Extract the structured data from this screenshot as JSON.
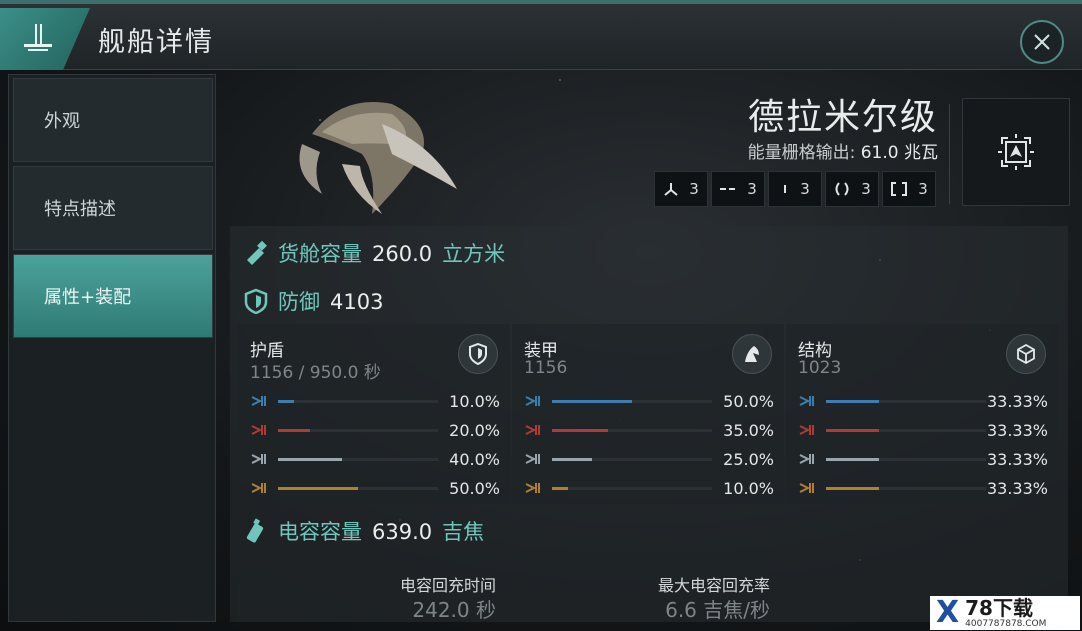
{
  "header": {
    "title": "舰船详情",
    "logo_icon": "ship-class-icon",
    "close_icon": "close-icon"
  },
  "sidebar": {
    "items": [
      {
        "label": "外观",
        "active": false
      },
      {
        "label": "特点描述",
        "active": false
      },
      {
        "label": "属性+装配",
        "active": true
      }
    ]
  },
  "ship": {
    "name": "德拉米尔级",
    "power_label": "能量栅格输出:",
    "power_value": "61.0 兆瓦",
    "slots": [
      {
        "icon": "high-slot-icon",
        "count": "3"
      },
      {
        "icon": "mid-slot-icon",
        "count": "3"
      },
      {
        "icon": "low-slot-icon",
        "count": "3"
      },
      {
        "icon": "rig-slot-icon",
        "count": "3"
      },
      {
        "icon": "subsystem-slot-icon",
        "count": "3"
      }
    ],
    "nav_icon": "navigation-icon"
  },
  "cargo": {
    "label": "货舱容量",
    "value": "260.0",
    "unit": "立方米"
  },
  "defense": {
    "label": "防御",
    "value": "4103",
    "layers": [
      {
        "name": "护盾",
        "sub": "1156 / 950.0 秒",
        "icon": "shield-icon",
        "resists": [
          "10.0%",
          "20.0%",
          "40.0%",
          "50.0%"
        ],
        "fractions": [
          0.1,
          0.2,
          0.4,
          0.5
        ]
      },
      {
        "name": "装甲",
        "sub": "1156",
        "icon": "armor-icon",
        "resists": [
          "50.0%",
          "35.0%",
          "25.0%",
          "10.0%"
        ],
        "fractions": [
          0.5,
          0.35,
          0.25,
          0.1
        ]
      },
      {
        "name": "结构",
        "sub": "1023",
        "icon": "structure-icon",
        "resists": [
          "33.33%",
          "33.33%",
          "33.33%",
          "33.33%"
        ],
        "fractions": [
          0.3333,
          0.3333,
          0.3333,
          0.3333
        ]
      }
    ]
  },
  "capacitor": {
    "label": "电容容量",
    "value": "639.0",
    "unit": "吉焦",
    "stats": [
      {
        "label": "电容回充时间",
        "value": "242.0 秒"
      },
      {
        "label": "最大电容回充率",
        "value": "6.6 吉焦/秒"
      }
    ]
  },
  "colors": {
    "accent": "#6fc6bd",
    "em": "#3b7fb0",
    "thermal": "#b03a35",
    "kinetic": "#9aa6ae",
    "explosive": "#b0802f"
  },
  "watermark": {
    "mark": "X",
    "brand": "78下载",
    "url": "4007787878.COM"
  }
}
